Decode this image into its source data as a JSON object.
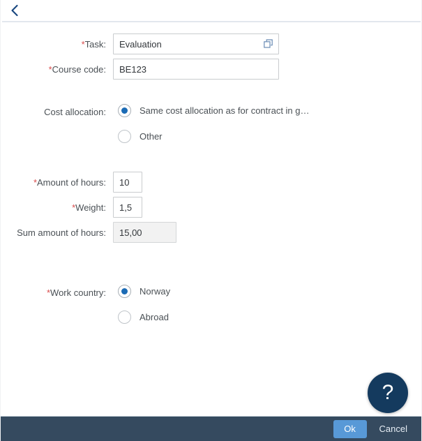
{
  "header": {
    "back_icon": "chevron-left-icon"
  },
  "form": {
    "task": {
      "label": "Task:",
      "required": true,
      "value": "Evaluation",
      "value_help_icon": "value-help-icon"
    },
    "course_code": {
      "label": "Course code:",
      "required": true,
      "value": "BE123"
    },
    "cost_allocation": {
      "label": "Cost allocation:",
      "required": false,
      "selected": "same",
      "options": [
        {
          "key": "same",
          "label": "Same cost allocation as for contract in g…"
        },
        {
          "key": "other",
          "label": "Other"
        }
      ]
    },
    "amount_of_hours": {
      "label": "Amount of hours:",
      "required": true,
      "value": "10"
    },
    "weight": {
      "label": "Weight:",
      "required": true,
      "value": "1,5"
    },
    "sum_amount_of_hours": {
      "label": "Sum amount of hours:",
      "required": false,
      "value": "15,00",
      "readonly": true
    },
    "work_country": {
      "label": "Work country:",
      "required": true,
      "selected": "norway",
      "options": [
        {
          "key": "norway",
          "label": "Norway"
        },
        {
          "key": "abroad",
          "label": "Abroad"
        }
      ]
    }
  },
  "help": {
    "icon": "question-mark-icon",
    "glyph": "?"
  },
  "footer": {
    "ok_label": "Ok",
    "cancel_label": "Cancel"
  },
  "colors": {
    "accent": "#5899d7",
    "footer_bg": "#354a5f",
    "required_marker": "#d94c4c",
    "fab_bg": "#143a5e",
    "radio_dot": "#1b6bb5"
  }
}
